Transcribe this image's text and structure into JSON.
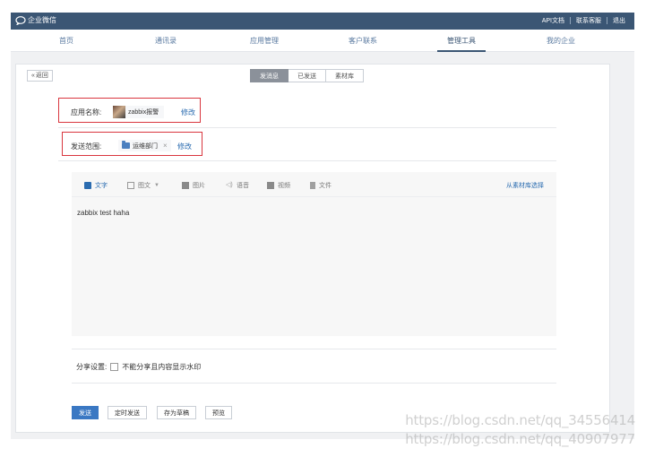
{
  "topbar": {
    "logo_text": "企业微信",
    "links": [
      "API文档",
      "联系客服",
      "退出"
    ]
  },
  "nav": {
    "items": [
      "首页",
      "通讯录",
      "应用管理",
      "客户联系",
      "管理工具",
      "我的企业"
    ],
    "active": "管理工具"
  },
  "page": {
    "back_label": "返回",
    "tabs": [
      "发消息",
      "已发送",
      "素材库"
    ],
    "active_tab": "发消息"
  },
  "form": {
    "app_label": "应用名称:",
    "app_name": "zabbix报警",
    "app_edit": "修改",
    "scope_label": "发送范围:",
    "scope_dept": "运维部门",
    "scope_remove": "×",
    "scope_edit": "修改"
  },
  "editor": {
    "tools": [
      {
        "label": "文字",
        "icon": "text-icon",
        "active": true
      },
      {
        "label": "图文",
        "icon": "news-icon",
        "has_dropdown": true
      },
      {
        "label": "图片",
        "icon": "image-icon"
      },
      {
        "label": "语音",
        "icon": "voice-icon"
      },
      {
        "label": "视频",
        "icon": "video-icon"
      },
      {
        "label": "文件",
        "icon": "file-icon"
      }
    ],
    "library_link": "从素材库选择",
    "content": "zabbix test haha"
  },
  "share": {
    "label": "分享设置:",
    "option": "不能分享且内容显示水印",
    "checked": false
  },
  "actions": {
    "send": "发送",
    "schedule": "定时发送",
    "draft": "存为草稿",
    "preview": "预览"
  },
  "watermarks": [
    "https://blog.csdn.net/qq_34556414",
    "https://blog.csdn.net/qq_40907977"
  ],
  "colors": {
    "topbar": "#3b5674",
    "primary_button": "#3a78c3",
    "link": "#2b6cb0",
    "highlight_box": "#d9363e"
  }
}
